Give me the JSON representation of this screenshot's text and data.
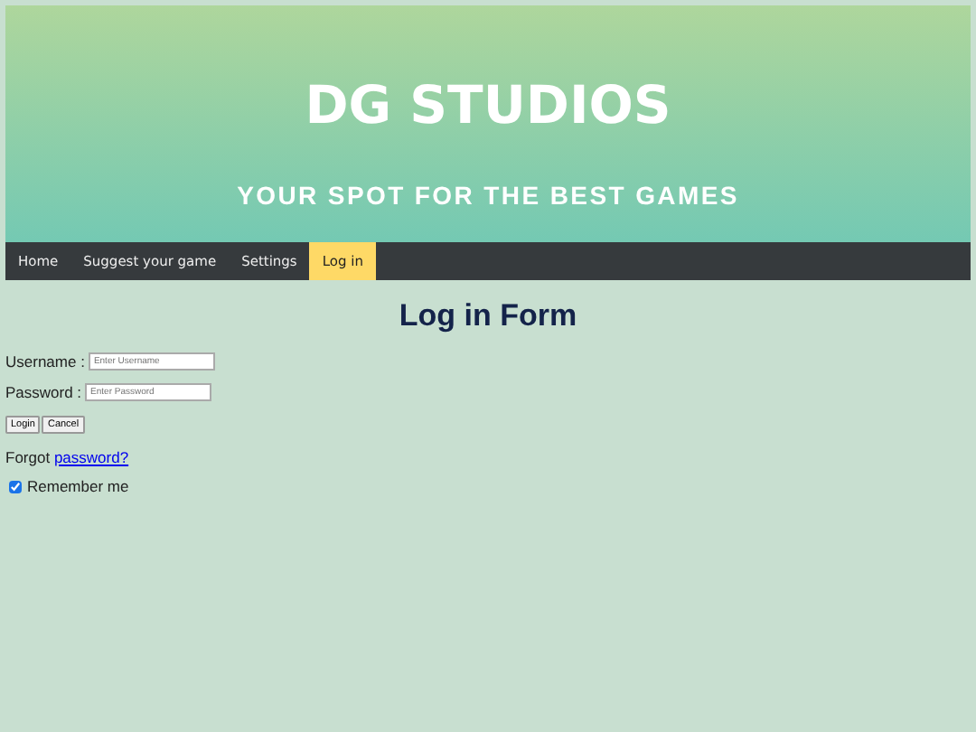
{
  "header": {
    "title": "DG STUDIOS",
    "subtitle": "YOUR SPOT FOR THE BEST GAMES"
  },
  "nav": [
    {
      "label": "Home",
      "selected": false
    },
    {
      "label": "Suggest your game",
      "selected": false
    },
    {
      "label": "Settings",
      "selected": false
    },
    {
      "label": "Log in",
      "selected": true
    }
  ],
  "form": {
    "title": "Log in Form",
    "fields": [
      {
        "label": "Username :",
        "placeholder": "Enter Username"
      },
      {
        "label": "Password :",
        "placeholder": "Enter Password"
      }
    ],
    "buttons": [
      "Login",
      "Cancel"
    ],
    "forgot": {
      "text": "Forgot",
      "link": "password?"
    },
    "remember": {
      "label": "Remember me",
      "checked": true
    }
  }
}
